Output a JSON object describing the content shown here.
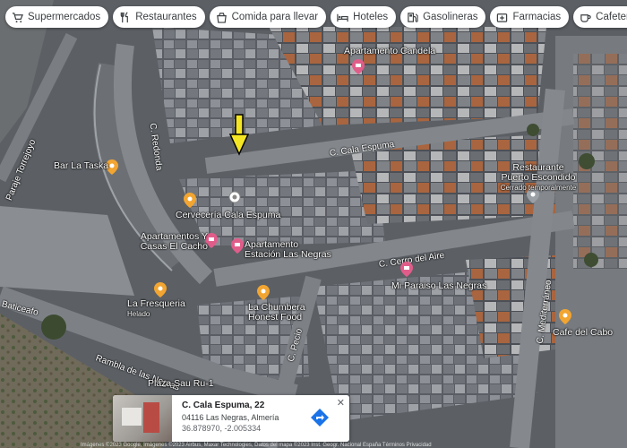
{
  "chips": [
    {
      "label": "Supermercados",
      "icon": "cart-icon"
    },
    {
      "label": "Restaurantes",
      "icon": "cutlery-icon"
    },
    {
      "label": "Comida para llevar",
      "icon": "takeout-icon"
    },
    {
      "label": "Hoteles",
      "icon": "bed-icon"
    },
    {
      "label": "Gasolineras",
      "icon": "fuel-icon"
    },
    {
      "label": "Farmacias",
      "icon": "pharmacy-icon"
    },
    {
      "label": "Cafeterías",
      "icon": "coffee-icon"
    }
  ],
  "streets": {
    "redonda": "C. Redonda",
    "cala_espuma": "C. Cala Espuma",
    "cerro_del_aire": "C. Cerro del Aire",
    "mediterraneo": "C. Mediterráneo",
    "pecio": "C. Pecio",
    "rambla": "Rambla de las Negras",
    "torrejoyo": "Paraje Torrejoyo",
    "baticeafo": "Baticeafo"
  },
  "pois": {
    "apartamento_candela": "Apartamento Candela",
    "bar_la_taska": "Bar La Taska",
    "restaurante_puerto_escondido": "Restaurante Puerto Escondido",
    "restaurante_status": "Cerrado temporalmente",
    "cerveceria_cala_espuma": "Cervecería Cala Espuma",
    "apartamentos_el_cacho": "Apartamentos Y Casas El Cacho",
    "apartamento_estacion": "Apartamento Estación Las Negras",
    "mi_paraiso": "Mi Paraiso Las Negras",
    "la_fresqueria": "La Fresqueria",
    "la_fresqueria_sub": "Helado",
    "la_chumbera": "La Chumbera Honest Food",
    "cafe_del_cabo": "Cafe del Cabo",
    "plaza_sau": "Plaza Sau Ru-1"
  },
  "card": {
    "title": "C. Cala Espuma, 22",
    "address": "04116 Las Negras, Almería",
    "coords": "36.878970, -2.005334"
  },
  "attribution": "Imágenes ©2023 Google, Imágenes ©2023 Airbus, Maxar Technologies, Datos del mapa ©2023 Inst. Geogr. Nacional   España   Términos   Privacidad",
  "colors": {
    "pink_pin": "#e05d8a",
    "orange_pin": "#f2a531",
    "gray_pin": "#9aa0a6",
    "arrow": "#f5e625"
  }
}
